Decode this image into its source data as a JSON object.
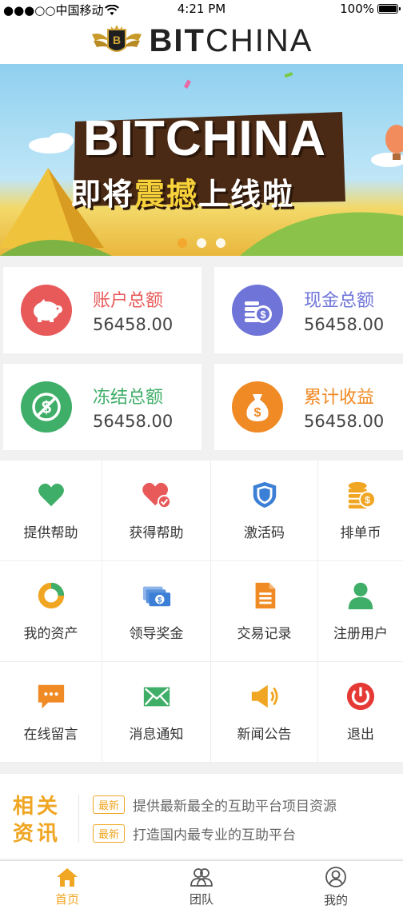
{
  "status_bar": {
    "carrier": "●●●○○中国移动",
    "time": "4:21 PM",
    "battery": "100%"
  },
  "header": {
    "brand_bold": "BIT",
    "brand_light": "CHINA"
  },
  "banner": {
    "headline": "BITCHINA",
    "subline_1": "即将",
    "subline_2": "震撼",
    "subline_3": "上线啦",
    "dots": 3
  },
  "cards": [
    {
      "title": "账户总额",
      "value": "56458.00",
      "color": "#e85a5a",
      "icon": "piggy-bank-icon"
    },
    {
      "title": "现金总额",
      "value": "56458.00",
      "color": "#6f74d8",
      "icon": "coins-icon"
    },
    {
      "title": "冻结总额",
      "value": "56458.00",
      "color": "#3fae68",
      "icon": "no-dollar-icon"
    },
    {
      "title": "累计收益",
      "value": "56458.00",
      "color": "#f08a24",
      "icon": "money-bag-icon"
    }
  ],
  "grid": [
    {
      "label": "提供帮助",
      "icon": "heart-icon"
    },
    {
      "label": "获得帮助",
      "icon": "heart-check-icon"
    },
    {
      "label": "激活码",
      "icon": "shield-icon"
    },
    {
      "label": "排单币",
      "icon": "coin-stack-icon"
    },
    {
      "label": "我的资产",
      "icon": "donut-chart-icon"
    },
    {
      "label": "领导奖金",
      "icon": "cash-icon"
    },
    {
      "label": "交易记录",
      "icon": "document-icon"
    },
    {
      "label": "注册用户",
      "icon": "user-icon"
    },
    {
      "label": "在线留言",
      "icon": "chat-bubble-icon"
    },
    {
      "label": "消息通知",
      "icon": "envelope-icon"
    },
    {
      "label": "新闻公告",
      "icon": "speaker-icon"
    },
    {
      "label": "退出",
      "icon": "power-icon"
    }
  ],
  "news": {
    "heading": "相关资讯",
    "badge": "最新",
    "items": [
      "提供最新最全的互助平台项目资源",
      "打造国内最专业的互助平台"
    ]
  },
  "tabbar": [
    {
      "label": "首页",
      "icon": "home-icon",
      "active": true
    },
    {
      "label": "团队",
      "icon": "team-icon",
      "active": false
    },
    {
      "label": "我的",
      "icon": "profile-icon",
      "active": false
    }
  ],
  "colors": {
    "accent": "#f0a623",
    "red": "#e85a5a",
    "purple": "#6f74d8",
    "green": "#3fae68",
    "orange": "#f08a24"
  }
}
